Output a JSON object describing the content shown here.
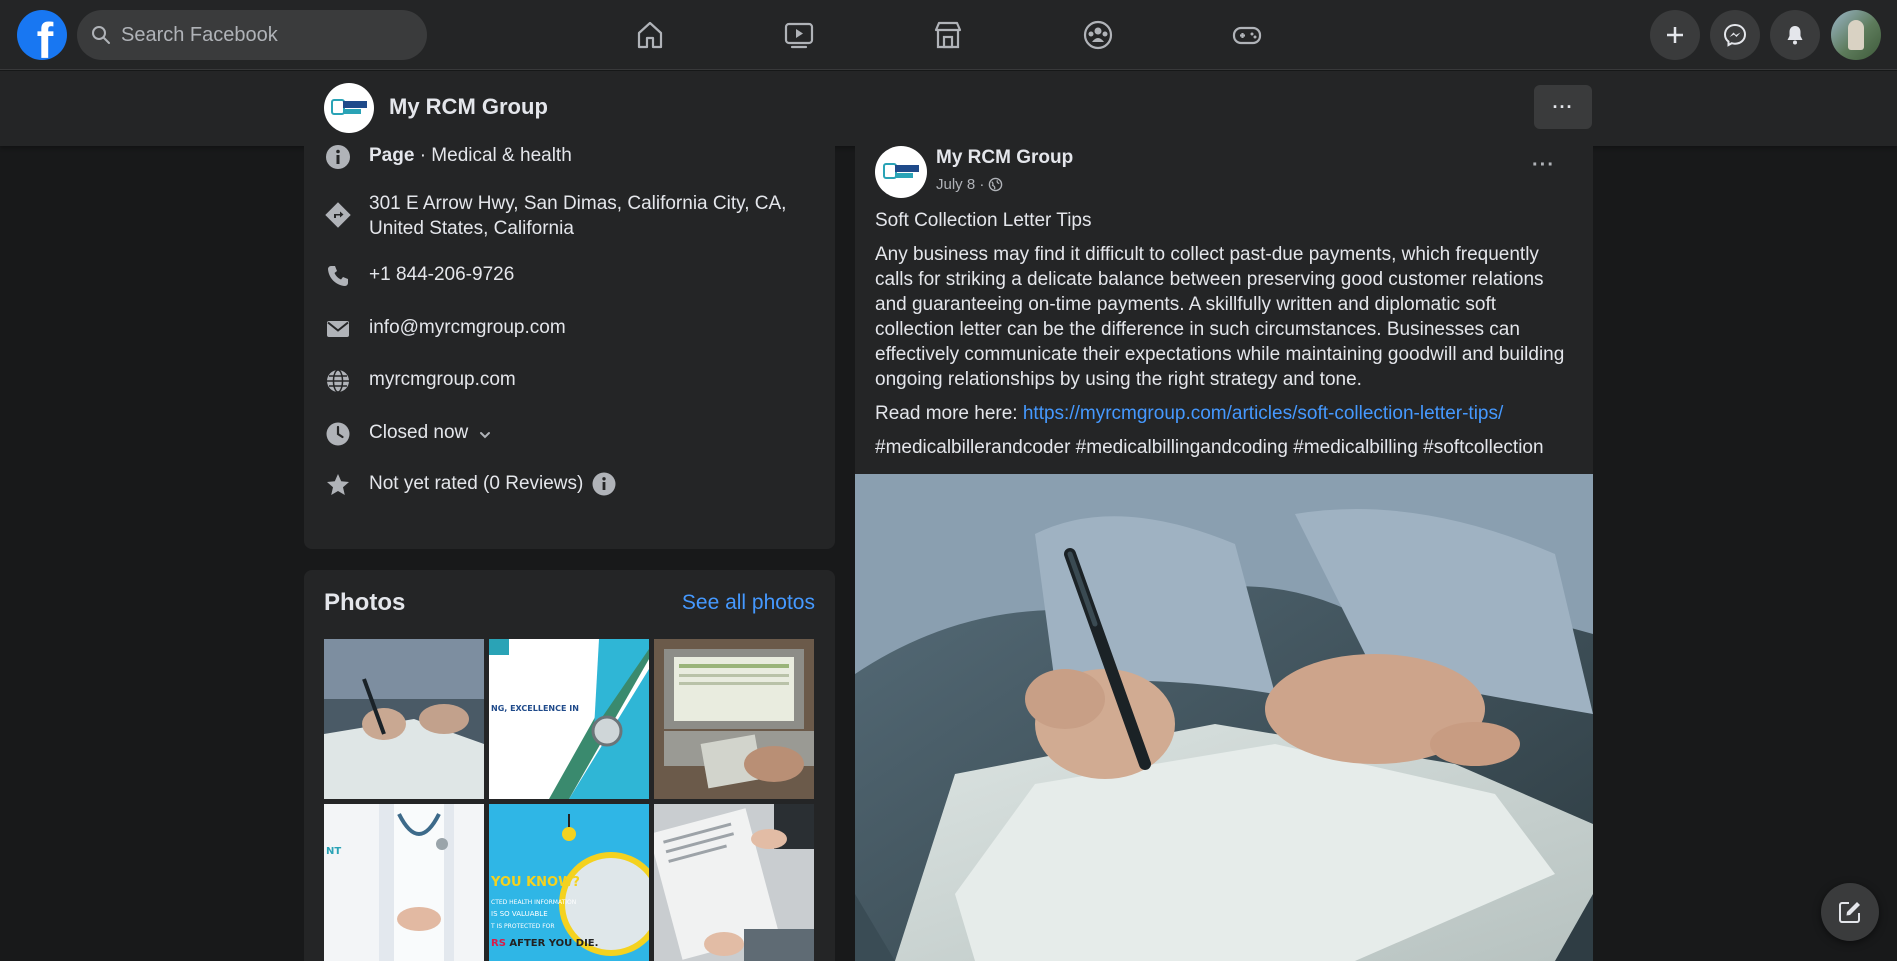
{
  "topbar": {
    "logo_letter": "f",
    "search_placeholder": "Search Facebook",
    "nav": [
      "home-icon",
      "watch-icon",
      "marketplace-icon",
      "groups-icon",
      "gaming-icon"
    ],
    "actions": [
      "plus-icon",
      "messenger-icon",
      "notifications-icon",
      "account-avatar"
    ]
  },
  "page": {
    "name": "My RCM Group",
    "more_label": "···"
  },
  "intro": {
    "category_bold": "Page",
    "category_rest": " · Medical & health",
    "address_line1": "301 E Arrow Hwy, San Dimas, California City, CA,",
    "address_line2": "United States, California",
    "phone": "+1 844-206-9726",
    "email": "info@myrcmgroup.com",
    "website": "myrcmgroup.com",
    "hours_status": "Closed now",
    "rating": "Not yet rated (0 Reviews)"
  },
  "photos": {
    "title": "Photos",
    "see_all": "See all photos",
    "captions": {
      "p2": "NG, EXCELLENCE IN",
      "p4": "NT",
      "p5_line1": "YOU KNOW?",
      "p5_line2": "CTED HEALTH INFORMATION",
      "p5_line3": "IS SO VALUABLE",
      "p5_line4": "T IS PROTECTED FOR",
      "p5_line5a": "RS",
      "p5_line5b": " AFTER YOU DIE."
    }
  },
  "post": {
    "author": "My RCM Group",
    "date": "July 8 ·",
    "heading": "Soft Collection Letter Tips",
    "body": "Any business may find it difficult to collect past-due payments, which frequently calls for striking a delicate balance between preserving good customer relations and guaranteeing on-time payments. A skillfully written and diplomatic soft collection letter can be the difference in such circumstances. Businesses can effectively communicate their expectations while maintaining goodwill and building ongoing relationships by using the right strategy and tone.",
    "read_more_label": "Read more here: ",
    "read_more_link": "https://myrcmgroup.com/articles/soft-collection-letter-tips/",
    "hashtags": "#medicalbillerandcoder #medicalbillingandcoding #medicalbilling #softcollection",
    "more_label": "···"
  },
  "colors": {
    "background": "#18191a",
    "surface": "#242526",
    "link": "#4599ff",
    "closed": "#f02849",
    "brand": "#1877f2"
  }
}
